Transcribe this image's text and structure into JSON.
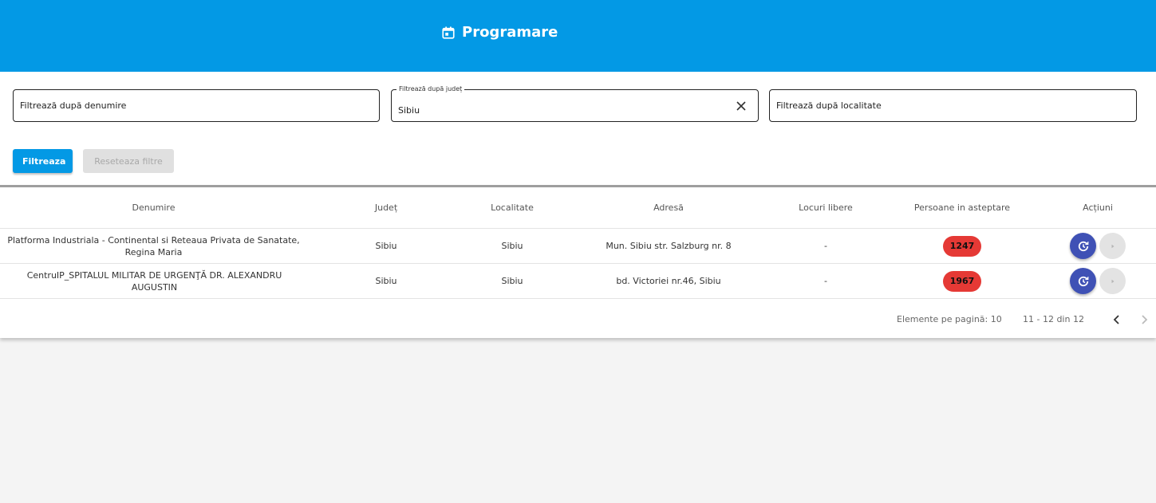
{
  "header": {
    "title": "Programare",
    "icon": "calendar-icon",
    "bg_color": "#0399e5"
  },
  "filters": {
    "name_placeholder": "Filtrează după denumire",
    "county_label": "Filtrează după județ",
    "county_value": "Sibiu",
    "locality_placeholder": "Filtrează după localitate",
    "filter_button": "Filtreaza",
    "reset_button": "Reseteaza filtre"
  },
  "table": {
    "columns": [
      "Denumire",
      "Județ",
      "Localitate",
      "Adresă",
      "Locuri libere",
      "Persoane in asteptare",
      "Acțiuni"
    ],
    "rows": [
      {
        "name": "Platforma Industriala - Continental si Reteaua Privata de Sanatate, Regina Maria",
        "county": "Sibiu",
        "locality": "Sibiu",
        "address": "Mun. Sibiu str. Salzburg nr. 8",
        "free_slots": "-",
        "waiting": "1247"
      },
      {
        "name": "CentruIP_SPITALUL MILITAR DE URGENŢĂ DR. ALEXANDRU AUGUSTIN",
        "county": "Sibiu",
        "locality": "Sibiu",
        "address": "bd. Victoriei nr.46, Sibiu",
        "free_slots": "-",
        "waiting": "1967"
      }
    ],
    "badge_color": "#e53935",
    "action_color": "#3f51b5"
  },
  "pager": {
    "per_page_label": "Elemente pe pagină: 10",
    "range_label": "11 - 12 din 12"
  }
}
